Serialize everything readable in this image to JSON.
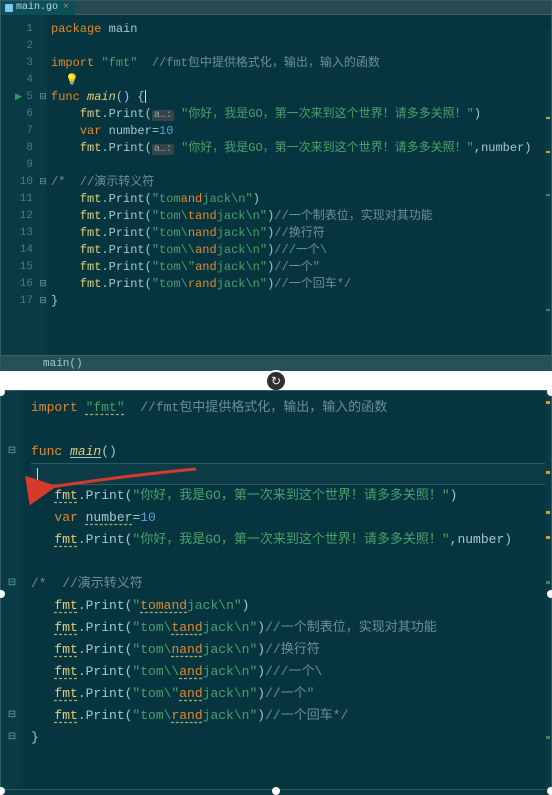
{
  "tab": {
    "filename": "main.go",
    "close": "×"
  },
  "breadcrumb": "main()",
  "refresh_icon": "↻",
  "top_lines": [
    {
      "n": "1",
      "kw": "package",
      "rest": " main"
    },
    {
      "n": "2",
      "blank": true
    },
    {
      "n": "3",
      "import": "import",
      "mod": "\"fmt\"",
      "cmt": "  //fmt包中提供格式化，输出，输入的函数"
    },
    {
      "n": "4",
      "bulb": true
    },
    {
      "n": "5",
      "func": "func ",
      "name": "main",
      "sig": "() {",
      "play": true,
      "fold": "⊟"
    },
    {
      "n": "6",
      "indent": "    ",
      "call": "fmt.Print(",
      "hint": "a…:",
      "str": "\"你好，我是GO，第一次来到这个世界！请多多关照！\"",
      "tail": ")"
    },
    {
      "n": "7",
      "indent": "    ",
      "kw": "var",
      "mid": " number=",
      "num": "10"
    },
    {
      "n": "8",
      "indent": "    ",
      "call": "fmt.Print(",
      "hint": "a…:",
      "str": "\"你好，我是GO，第一次来到这个世界！请多多关照！\"",
      "tail": ",number)"
    },
    {
      "n": "9",
      "blank": true
    },
    {
      "n": "10",
      "fold": "⊟",
      "cmt": "/*  //演示转义符"
    },
    {
      "n": "11",
      "indent": "    ",
      "call": "fmt.Print(",
      "str1": "\"tom",
      "esc": "and",
      "str2": "jack",
      "str3": "\\n\"",
      "tail": ")"
    },
    {
      "n": "12",
      "indent": "    ",
      "call": "fmt.Print(",
      "str1": "\"tom\\",
      "esc": "tand",
      "str2": "jack",
      "str3": "\\n\"",
      "tail": ")",
      "cmt": "//一个制表位，实现对其功能"
    },
    {
      "n": "13",
      "indent": "    ",
      "call": "fmt.Print(",
      "str1": "\"tom\\",
      "esc": "nand",
      "str2": "jack",
      "str3": "\\n\"",
      "tail": ")",
      "cmt": "//换行符"
    },
    {
      "n": "14",
      "indent": "    ",
      "call": "fmt.Print(",
      "str1": "\"tom\\\\",
      "esc": "and",
      "str2": "jack",
      "str3": "\\n\"",
      "tail": ")",
      "cmt": "///一个\\"
    },
    {
      "n": "15",
      "indent": "    ",
      "call": "fmt.Print(",
      "str1": "\"tom\\\"",
      "esc": "and",
      "str2": "jack",
      "str3": "\\n\"",
      "tail": ")",
      "cmt": "//一个\""
    },
    {
      "n": "16",
      "indent": "    ",
      "call": "fmt.Print(",
      "str1": "\"tom\\",
      "esc": "rand",
      "str2": "jack",
      "str3": "\\n\"",
      "tail": ")",
      "cmt": "//一个回车*/",
      "fold": "⊟"
    },
    {
      "n": "17",
      "brace": "}",
      "fold": "⊟"
    }
  ],
  "bottom_lines": [
    {
      "import": "import",
      "mod": "\"fmt\"",
      "modul": true,
      "cmt": "  //fmt包中提供格式化，输出，输入的函数"
    },
    {
      "blank": true
    },
    {
      "func": "func ",
      "name": "main",
      "nameul": true,
      "sig": "()",
      "fold": "⊟"
    },
    {
      "hl": true,
      "cursor": true
    },
    {
      "indent": "   ",
      "obj": "fmt",
      "dot": ".Print(",
      "str": "\"你好，我是GO，第一次来到这个世界！请多多关照！\"",
      "tail": ")"
    },
    {
      "indent": "   ",
      "kw": "var",
      "mid": " ",
      "var": "number",
      "varul": true,
      "eq": "=",
      "num": "10"
    },
    {
      "indent": "   ",
      "obj": "fmt",
      "dot": ".Print(",
      "str": "\"你好，我是GO，第一次来到这个世界！请多多关照！\"",
      "tail": ",number)"
    },
    {
      "blank": true
    },
    {
      "fold": "⊟",
      "cmt": "/*  //演示转义符"
    },
    {
      "indent": "   ",
      "obj": "fmt",
      "dot": ".Print(",
      "str1": "\"",
      "esc": "tomand",
      "str2": "jack",
      "str3": "\\n\"",
      "tail": ")"
    },
    {
      "indent": "   ",
      "obj": "fmt",
      "dot": ".Print(",
      "str1": "\"tom\\",
      "esc": "tand",
      "str2": "jack",
      "str3": "\\n\"",
      "tail": ")",
      "cmt": "//一个制表位，实现对其功能"
    },
    {
      "indent": "   ",
      "obj": "fmt",
      "dot": ".Print(",
      "str1": "\"tom\\",
      "esc": "nand",
      "str2": "jack",
      "str3": "\\n\"",
      "tail": ")",
      "cmt": "//换行符"
    },
    {
      "indent": "   ",
      "obj": "fmt",
      "dot": ".Print(",
      "str1": "\"tom\\\\",
      "esc": "and",
      "str2": "jack",
      "str3": "\\n\"",
      "tail": ")",
      "cmt": "///一个\\"
    },
    {
      "indent": "   ",
      "obj": "fmt",
      "dot": ".Print(",
      "str1": "\"tom\\\"",
      "esc": "and",
      "str2": "jack",
      "str3": "\\n\"",
      "tail": ")",
      "cmt": "//一个\""
    },
    {
      "indent": "   ",
      "obj": "fmt",
      "dot": ".Print(",
      "str1": "\"tom\\",
      "esc": "rand",
      "str2": "jack",
      "str3": "\\n\"",
      "tail": ")",
      "cmt": "//一个回车*/",
      "fold": "⊟"
    },
    {
      "brace": "}",
      "fold": "⊟"
    }
  ]
}
